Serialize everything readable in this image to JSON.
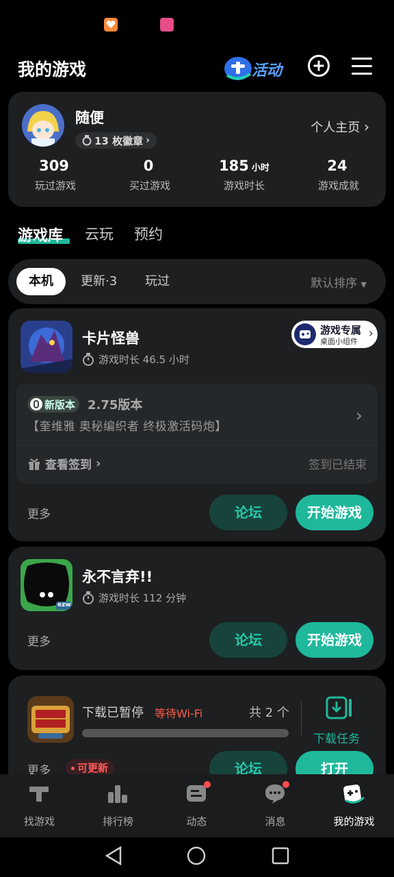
{
  "header": {
    "title": "我的游戏",
    "activity_label": "活动"
  },
  "profile": {
    "username": "随便",
    "badges": "13 枚徽章",
    "homepage_link": "个人主页",
    "stats": [
      {
        "value": "309",
        "unit": "",
        "label": "玩过游戏"
      },
      {
        "value": "0",
        "unit": "",
        "label": "买过游戏"
      },
      {
        "value": "185",
        "unit": "小时",
        "label": "游戏时长"
      },
      {
        "value": "24",
        "unit": "",
        "label": "游戏成就"
      }
    ]
  },
  "tabs": [
    "游戏库",
    "云玩",
    "预约"
  ],
  "filters": {
    "chips": [
      "本机",
      "更新·3",
      "玩过"
    ],
    "sort": "默认排序"
  },
  "games": [
    {
      "name": "卡片怪兽",
      "playtime": "游戏时长 46.5 小时",
      "widget_title": "游戏专属",
      "widget_sub": "桌面小组件",
      "update_badge": "新版本",
      "version": "2.75版本",
      "version_desc": "【奎维雅 奥秘编织者 终极激活码炮】",
      "signin_link": "查看签到",
      "signin_status": "签到已结束",
      "more": "更多",
      "forum": "论坛",
      "start": "开始游戏"
    },
    {
      "name": "永不言弃!!",
      "playtime": "游戏时长 112 分钟",
      "icon_tag": "ezw",
      "more": "更多",
      "forum": "论坛",
      "start": "开始游戏"
    },
    {
      "download_status": "下载已暂停",
      "download_wait": "等待Wi-Fi",
      "download_count": "共 2 个",
      "download_tasks": "下载任务",
      "download_progress": 0,
      "more": "更多",
      "updatable": "可更新",
      "forum": "论坛",
      "open": "打开"
    }
  ],
  "bottom_nav": [
    {
      "label": "找游戏",
      "icon": "taptap-icon"
    },
    {
      "label": "排行榜",
      "icon": "ranking-icon"
    },
    {
      "label": "动态",
      "icon": "feed-icon"
    },
    {
      "label": "消息",
      "icon": "message-icon"
    },
    {
      "label": "我的游戏",
      "icon": "gamepad-icon"
    }
  ],
  "colors": {
    "accent": "#1fb89b",
    "card": "#1d1f21",
    "badge_red": "#ff4d4f"
  }
}
